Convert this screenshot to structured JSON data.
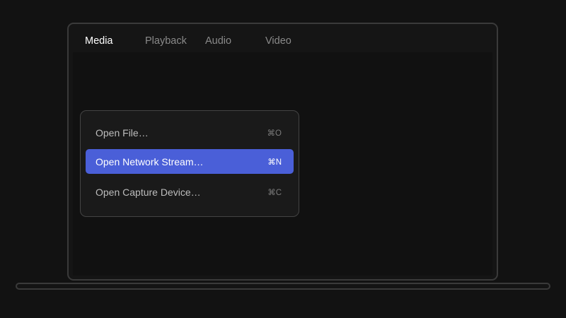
{
  "menubar": {
    "items": [
      {
        "label": "Media",
        "active": true
      },
      {
        "label": "Playback",
        "active": false
      },
      {
        "label": "Audio",
        "active": false
      },
      {
        "label": "Video",
        "active": false
      }
    ]
  },
  "dropdown": {
    "items": [
      {
        "label": "Open File…",
        "shortcut": "⌘O",
        "highlighted": false
      },
      {
        "label": "Open Network Stream…",
        "shortcut": "⌘N",
        "highlighted": true
      },
      {
        "label": "Open Capture Device…",
        "shortcut": "⌘C",
        "highlighted": false
      }
    ]
  },
  "colors": {
    "background": "#121212",
    "highlight": "#4a5fd8",
    "active_text": "#ffffff",
    "inactive_text": "#8a8a8a"
  }
}
